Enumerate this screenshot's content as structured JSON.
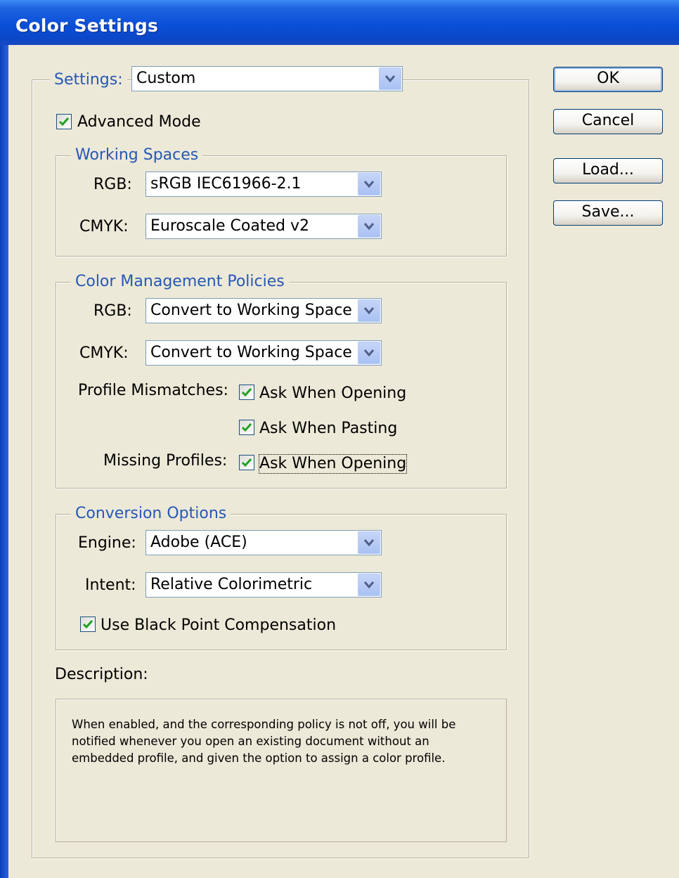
{
  "window": {
    "title": "Color Settings"
  },
  "settings": {
    "label": "Settings:",
    "value": "Custom"
  },
  "advanced_mode": {
    "label": "Advanced Mode",
    "checked": true
  },
  "working_spaces": {
    "legend": "Working Spaces",
    "rgb_label": "RGB:",
    "rgb_value": "sRGB IEC61966-2.1",
    "cmyk_label": "CMYK:",
    "cmyk_value": "Euroscale Coated v2"
  },
  "policies": {
    "legend": "Color Management Policies",
    "rgb_label": "RGB:",
    "rgb_value": "Convert to Working Space",
    "cmyk_label": "CMYK:",
    "cmyk_value": "Convert to Working Space",
    "profile_mismatches_label": "Profile Mismatches:",
    "ask_opening_label": "Ask When Opening",
    "ask_opening_checked": true,
    "ask_pasting_label": "Ask When Pasting",
    "ask_pasting_checked": true,
    "missing_profiles_label": "Missing Profiles:",
    "missing_ask_opening_label": "Ask When Opening",
    "missing_ask_opening_checked": true
  },
  "conversion": {
    "legend": "Conversion Options",
    "engine_label": "Engine:",
    "engine_value": "Adobe (ACE)",
    "intent_label": "Intent:",
    "intent_value": "Relative Colorimetric",
    "bpc_label": "Use Black Point Compensation",
    "bpc_checked": true
  },
  "description": {
    "label": "Description:",
    "text": "When enabled, and the corresponding policy is not off, you will be notified whenever you open an existing document without an embedded profile, and given the option to assign a color profile."
  },
  "buttons": {
    "ok": "OK",
    "cancel": "Cancel",
    "load": "Load...",
    "save": "Save..."
  },
  "colors": {
    "title_bar": "#0A4FD8",
    "dialog_bg": "#ECE9D8",
    "group_label": "#2658B5",
    "check_mark": "#21A121"
  }
}
